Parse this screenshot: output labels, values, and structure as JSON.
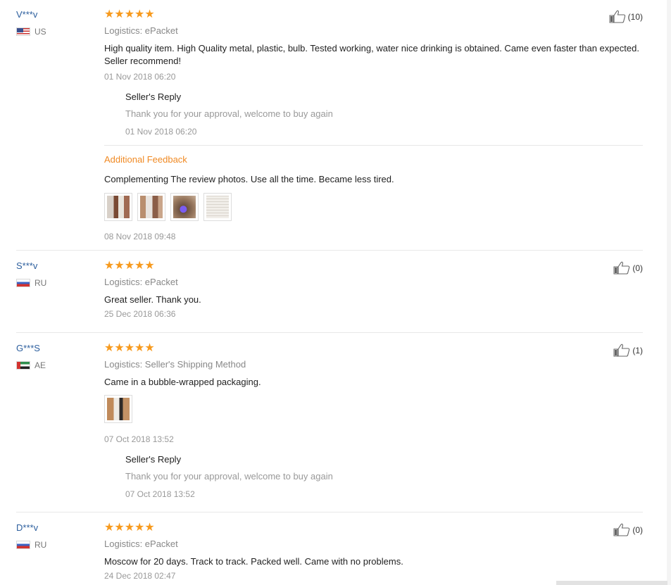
{
  "colors": {
    "star": "#f79a1e",
    "user_link": "#2d5f9e",
    "additional": "#f08a24",
    "muted": "#999999"
  },
  "reviews": [
    {
      "user": "V***v",
      "country": "US",
      "flag": "us-flag-icon",
      "stars": "★★★★★",
      "logistics": "Logistics: ePacket",
      "text": "High quality item. High Quality metal, plastic, bulb. Tested working, water nice drinking is obtained. Came even faster than expected. Seller recommend!",
      "date": "01 Nov 2018 06:20",
      "likes": "(10)",
      "reply": {
        "title": "Seller's Reply",
        "text": "Thank you for your approval, welcome to buy again",
        "date": "01 Nov 2018 06:20"
      },
      "additional": {
        "label": "Additional Feedback",
        "text": "Complementing The review photos. Use all the time. Became less tired.",
        "date": "08 Nov 2018 09:48",
        "photo_count": 4
      }
    },
    {
      "user": "S***v",
      "country": "RU",
      "flag": "ru-flag-icon",
      "stars": "★★★★★",
      "logistics": "Logistics: ePacket",
      "text": "Great seller. Thank you.",
      "date": "25 Dec 2018 06:36",
      "likes": "(0)"
    },
    {
      "user": "G***S",
      "country": "AE",
      "flag": "ae-flag-icon",
      "stars": "★★★★★",
      "logistics": "Logistics: Seller's Shipping Method",
      "text": "Came in a bubble-wrapped packaging.",
      "date": "07 Oct 2018 13:52",
      "likes": "(1)",
      "photo_count": 1,
      "reply": {
        "title": "Seller's Reply",
        "text": "Thank you for your approval, welcome to buy again",
        "date": "07 Oct 2018 13:52"
      }
    },
    {
      "user": "D***v",
      "country": "RU",
      "flag": "ru-flag-icon",
      "stars": "★★★★★",
      "logistics": "Logistics: ePacket",
      "text": "Moscow for 20 days. Track to track. Packed well. Came with no problems.",
      "date": "24 Dec 2018 02:47",
      "likes": "(0)"
    }
  ]
}
